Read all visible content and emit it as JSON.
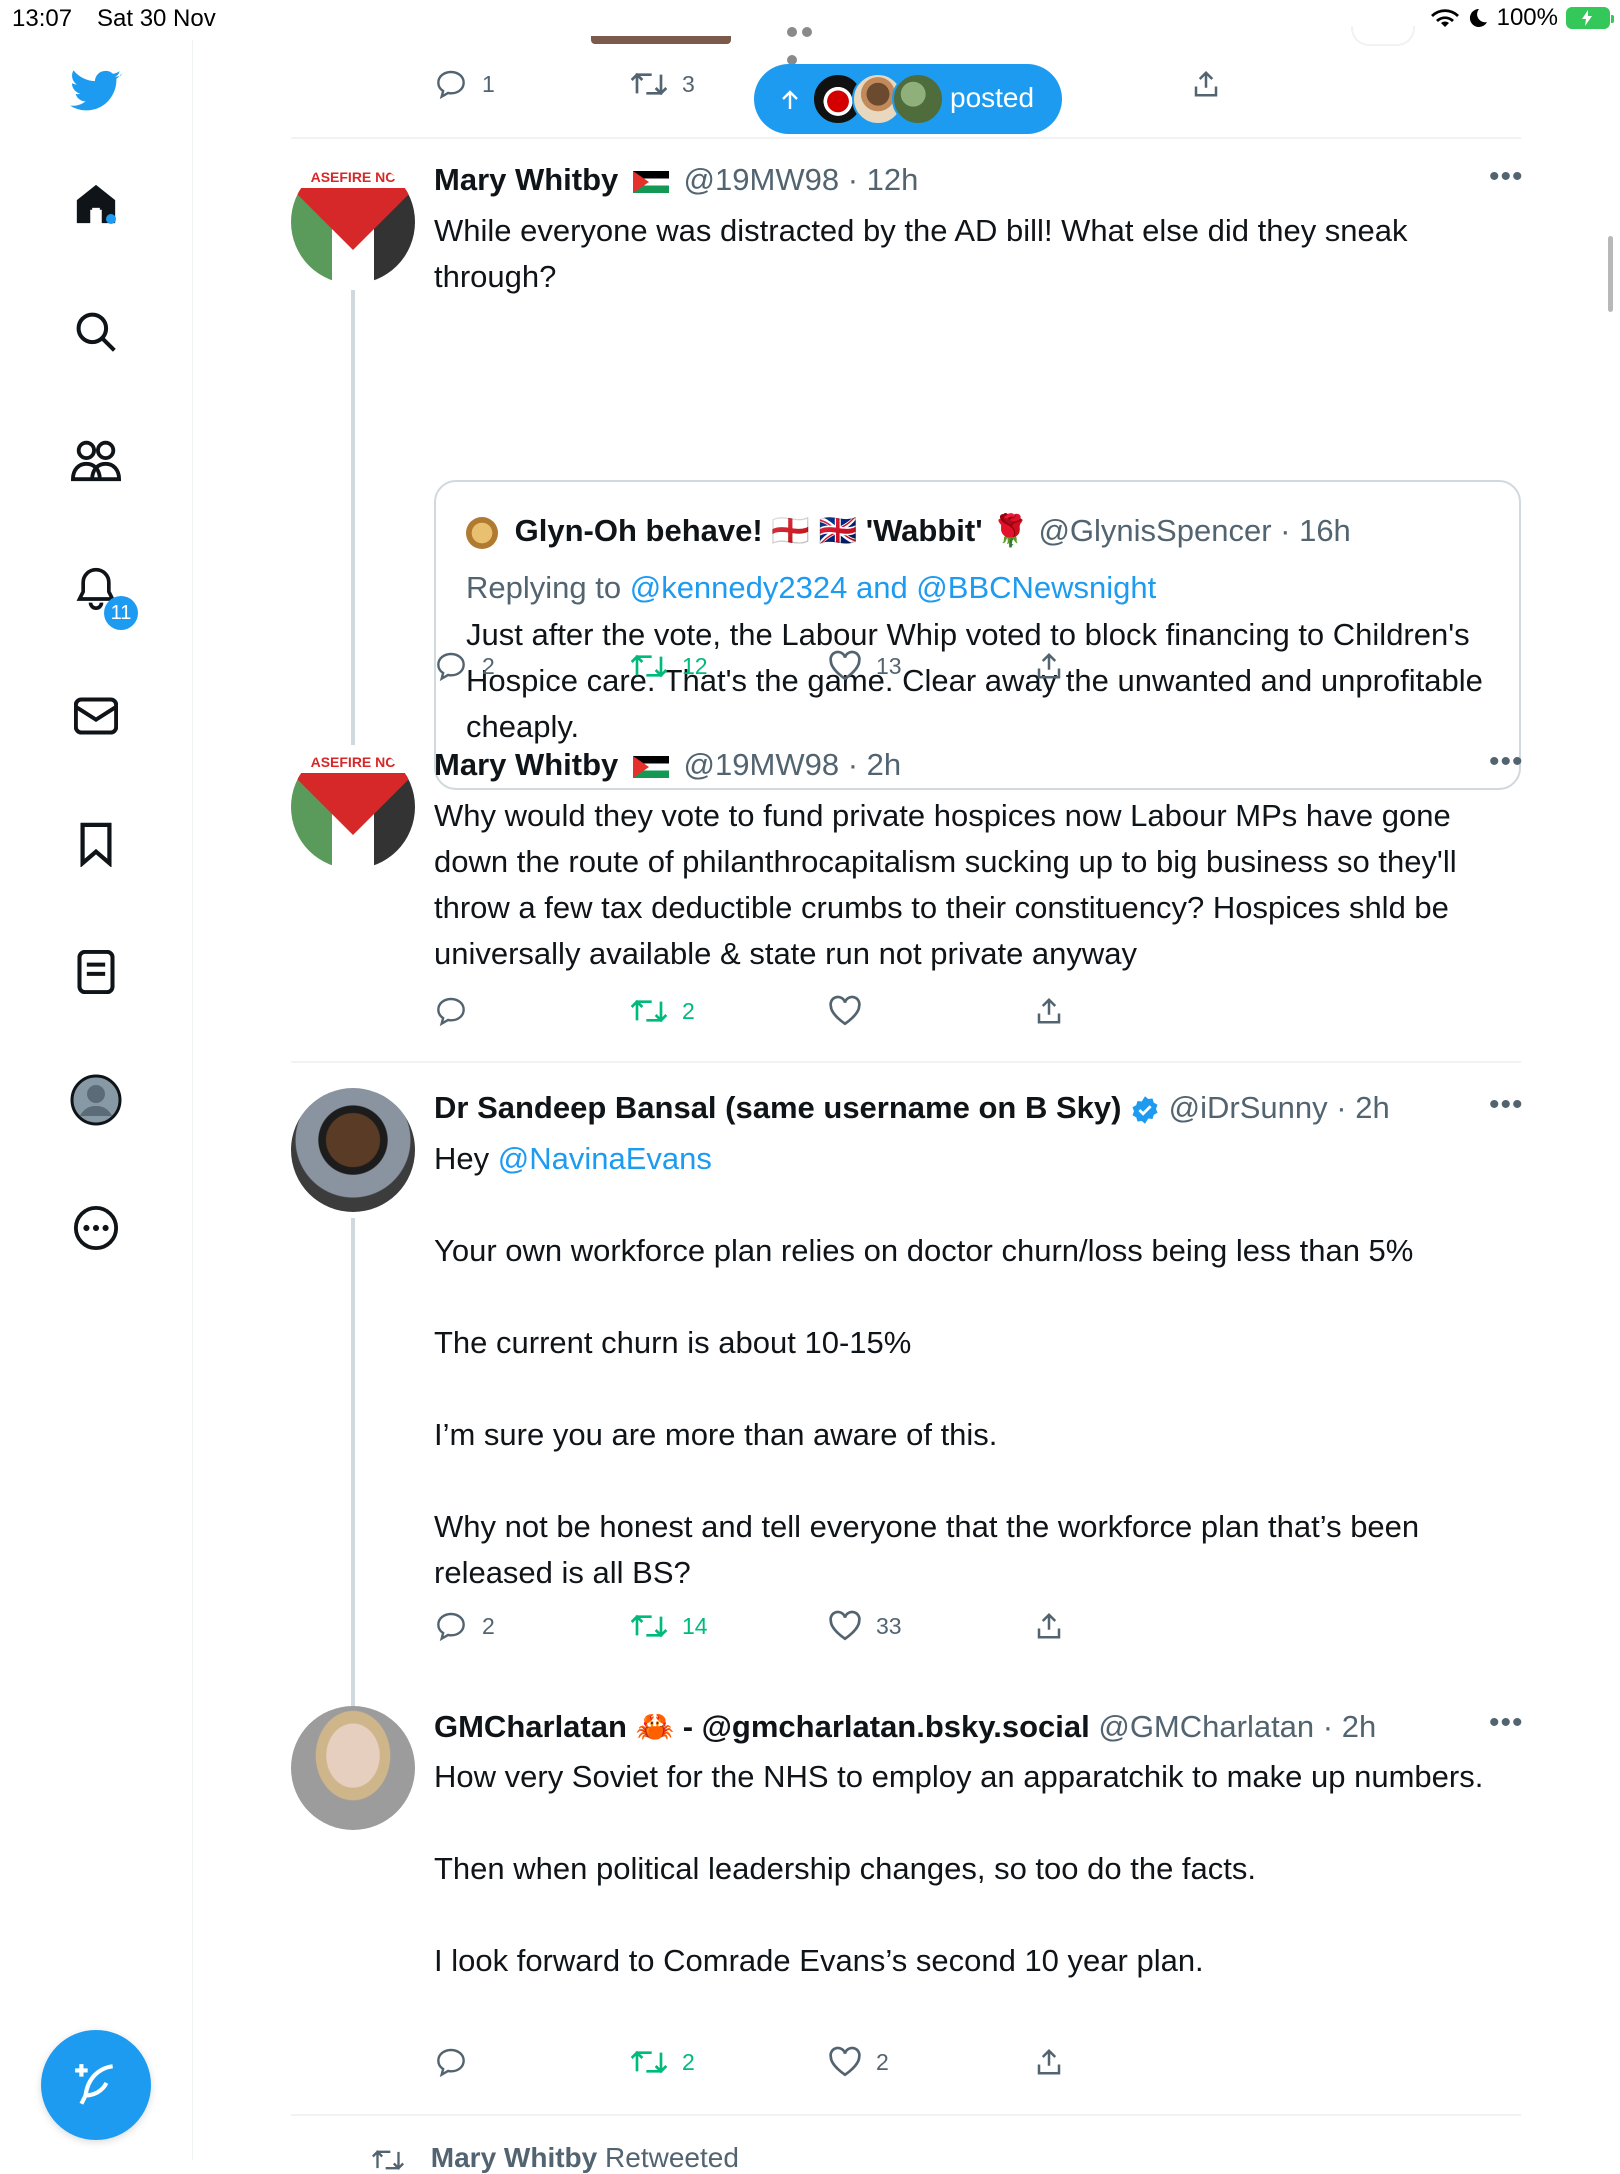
{
  "status_bar": {
    "time": "13:07",
    "date": "Sat 30 Nov",
    "battery": "100%"
  },
  "sidebar": {
    "notification_count": "11"
  },
  "new_posts_pill": {
    "label": "posted"
  },
  "top_actions": {
    "replies": "1",
    "retweets": "3"
  },
  "tweets": [
    {
      "name": "Mary Whitby",
      "handle": "@19MW98",
      "time": "· 12h",
      "text": "While everyone was distracted by the AD bill! What else did they sneak through?",
      "quote": {
        "name": "Glyn-Oh behave! 🏴󠁧󠁢󠁥󠁮󠁧󠁿 🇬🇧 'Wabbit' 🌹",
        "handle": "@GlynisSpencer",
        "time": "· 16h",
        "replying_prefix": "Replying to ",
        "replying_to": "@kennedy2324 and @BBCNewsnight",
        "text": "Just after the vote, the Labour Whip voted to block financing to Children's Hospice care. That's the game. Clear away the unwanted and unprofitable cheaply."
      },
      "replies": "2",
      "retweets": "12",
      "likes": "13"
    },
    {
      "name": "Mary Whitby",
      "handle": "@19MW98",
      "time": "· 2h",
      "text": "Why would they vote to fund private hospices now Labour MPs have gone down the route of philanthrocapitalism sucking up to big business so they'll throw a few tax deductible crumbs to their constituency? Hospices shld be universally available & state run not private anyway",
      "replies": "",
      "retweets": "2",
      "likes": ""
    },
    {
      "name": "Dr Sandeep Bansal (same username on B Sky)",
      "handle": "@iDrSunny",
      "time": "· 2h",
      "mention_prefix": "Hey ",
      "mention": "@NavinaEvans",
      "text": "Your own workforce plan relies on doctor churn/loss being less than 5%\n\nThe current churn is about 10-15%\n\nI’m sure you are more than aware of this.\n\nWhy not be honest and tell everyone that the workforce plan that’s been released is all BS?",
      "replies": "2",
      "retweets": "14",
      "likes": "33"
    },
    {
      "name": "GMCharlatan 🦀 - @gmcharlatan.bsky.social",
      "handle": "@GMCharlatan",
      "time": "· 2h",
      "text": "How very Soviet for the NHS to employ an apparatchik to make up numbers.\n\nThen when political leadership changes, so too do the facts.\n\nI look forward to Comrade Evans’s second 10 year plan.",
      "replies": "",
      "retweets": "2",
      "likes": "2"
    }
  ],
  "next_item": {
    "name": "Mary Whitby",
    "label": "Retweeted"
  }
}
